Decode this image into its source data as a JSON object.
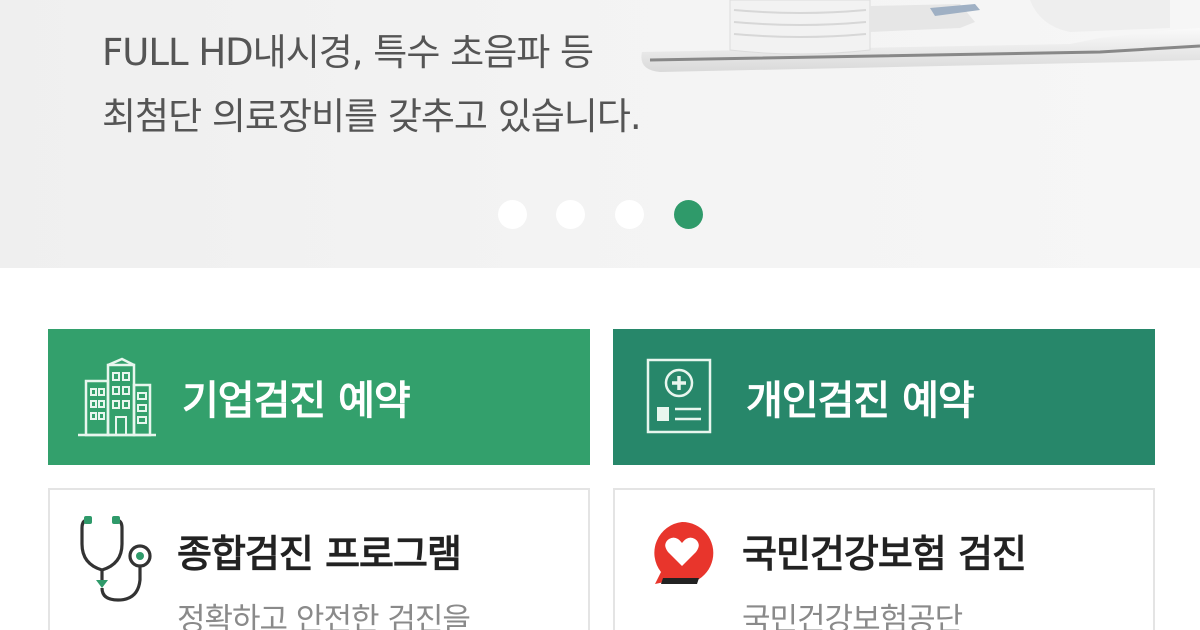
{
  "hero": {
    "line1": "FULL HD내시경, 특수 초음파 등",
    "line2": "최첨단 의료장비를 갖추고 있습니다.",
    "slides_total": 4,
    "active_slide": 4
  },
  "reservation": {
    "corporate_label": "기업검진 예약",
    "personal_label": "개인검진 예약"
  },
  "programs": {
    "comprehensive_title": "종합검진 프로그램",
    "comprehensive_desc": "정확하고 안전한 검진을",
    "nhis_title": "국민건강보험 검진",
    "nhis_desc": "국민건강보험공단"
  },
  "colors": {
    "corporate_bg": "#33a06c",
    "personal_bg": "#27876a",
    "active_dot": "#2f9a6a",
    "heart_red": "#e8352c"
  },
  "icons": {
    "corporate": "building-icon",
    "personal": "medical-card-icon",
    "comprehensive": "stethoscope-icon",
    "nhis": "heart-speech-bubble-icon"
  }
}
